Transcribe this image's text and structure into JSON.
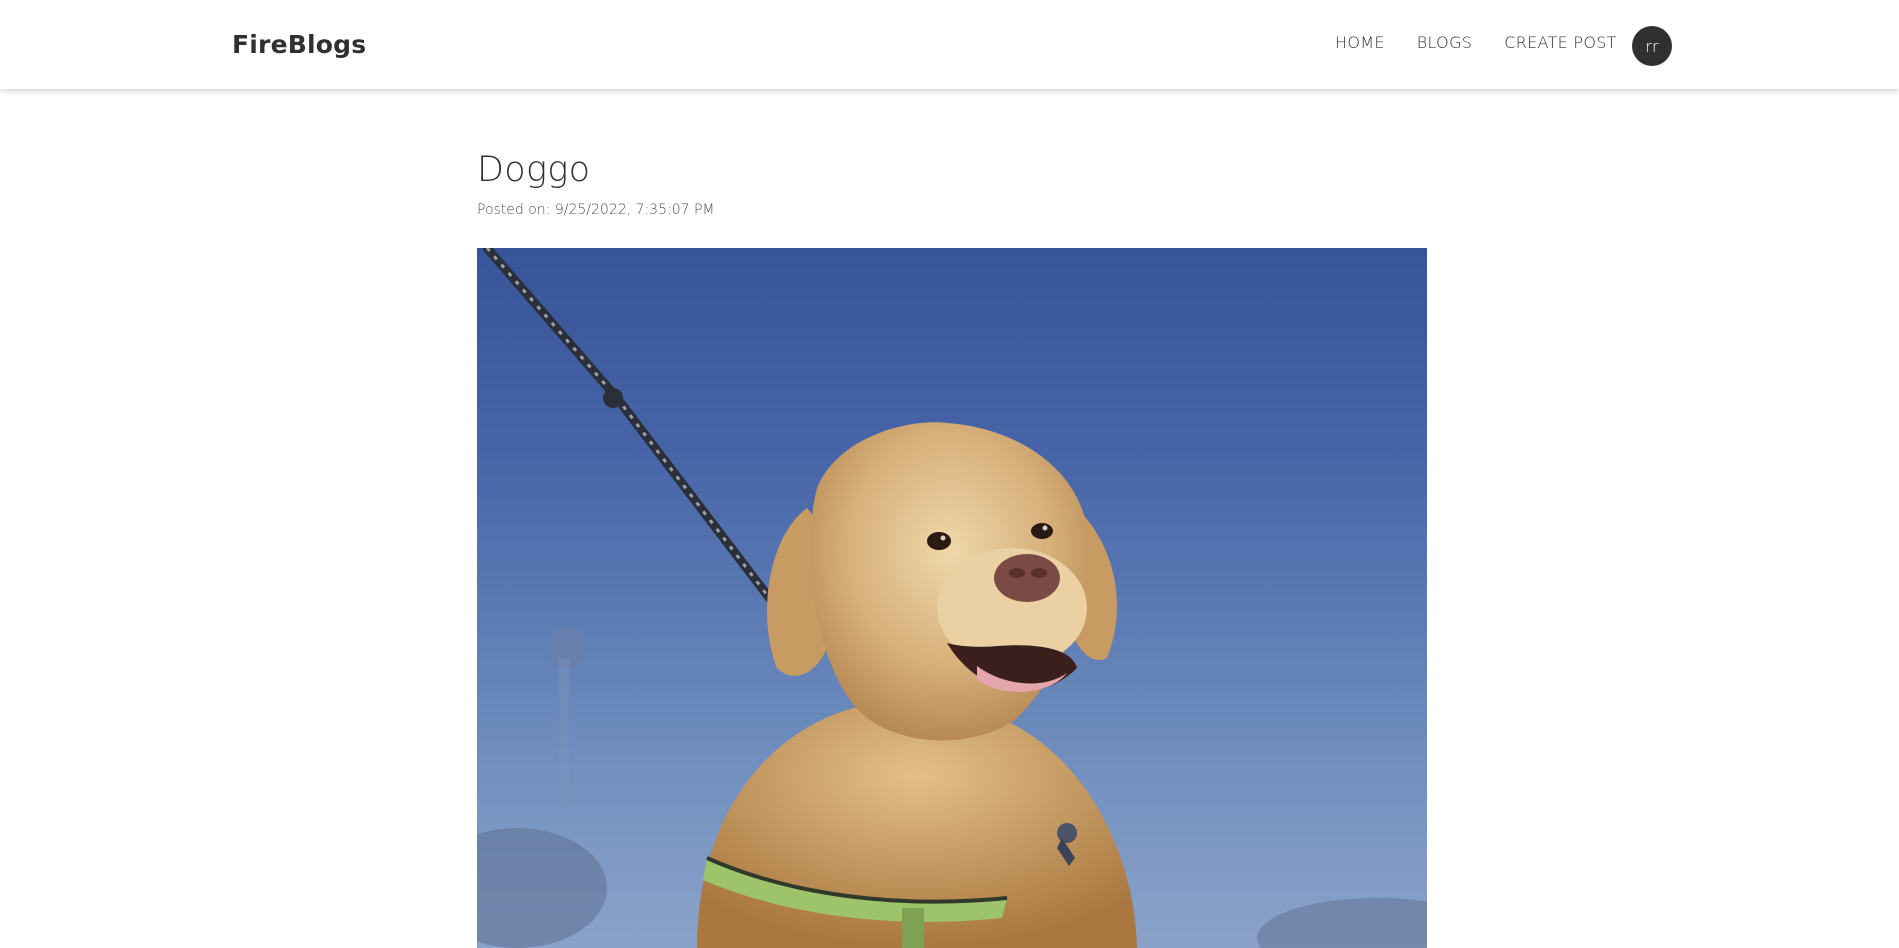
{
  "header": {
    "brand": "FireBlogs",
    "nav": {
      "home": "HOME",
      "blogs": "BLOGS",
      "create_post": "CREATE POST"
    },
    "avatar_initials": "rr"
  },
  "post": {
    "title": "Doggo",
    "date_label": "Posted on: 9/25/2022, 7:35:07 PM",
    "image_subject": "golden retriever on leash against blue sky"
  },
  "colors": {
    "text": "#303030",
    "avatar_bg": "#303030",
    "sky_top": "#38549a",
    "sky_bottom": "#8aa2c8"
  }
}
